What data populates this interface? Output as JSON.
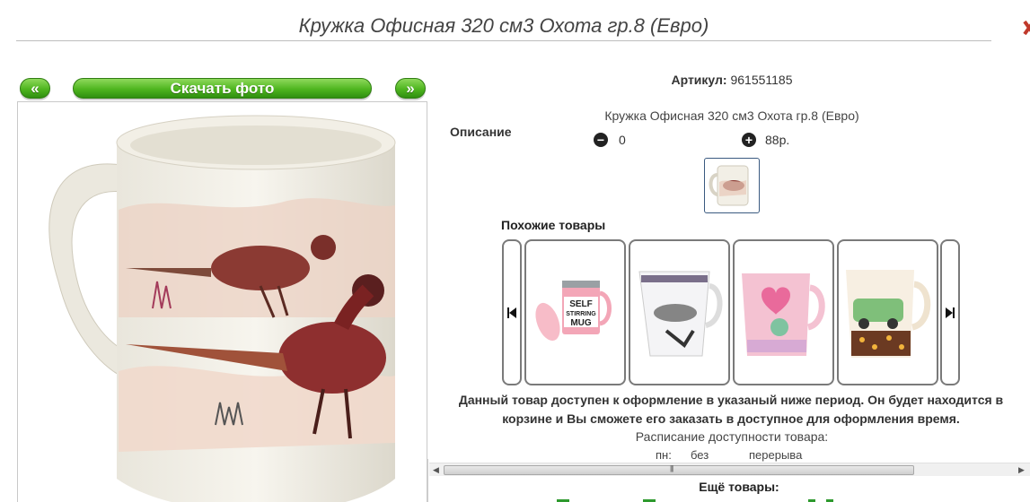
{
  "page": {
    "title": "Кружка Офисная 320 см3 Охота гр.8 (Евро)"
  },
  "gallery": {
    "prev_label": "«",
    "download_label": "Скачать фото",
    "next_label": "»"
  },
  "product": {
    "article_label": "Артикул:",
    "article_value": "961551185",
    "description_label": "Описание",
    "description_text": "Кружка Офисная 320 см3 Охота гр.8 (Евро)",
    "quantity": "0",
    "price": "88р."
  },
  "similar": {
    "title": "Похожие товары",
    "items": [
      {
        "name": "self-stirring-mug"
      },
      {
        "name": "fashion-mug"
      },
      {
        "name": "heart-flower-mug"
      },
      {
        "name": "retro-car-mug"
      }
    ]
  },
  "availability": {
    "notice": "Данный товар доступен к оформление в указаный ниже период. Он будет находится в корзине и Вы сможете его заказать в доступное для оформления время.",
    "schedule_title": "Расписание доступности товара:",
    "day": "пн:",
    "value1": "без",
    "value2": "перерыва"
  },
  "more": {
    "title": "Ещё товары:"
  },
  "colors": {
    "button_green": "#4eb51f",
    "accent_red": "#c0392b"
  }
}
